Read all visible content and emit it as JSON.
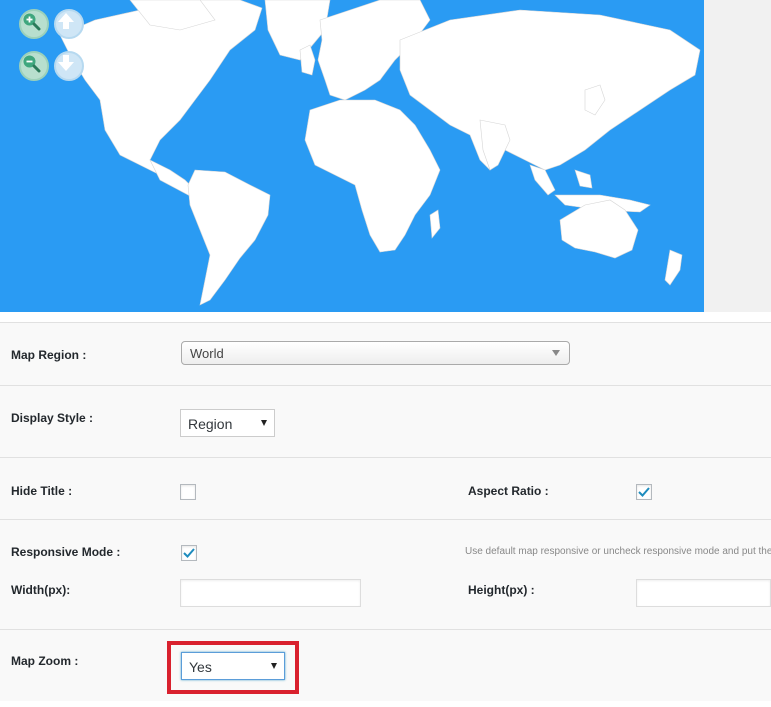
{
  "map": {
    "zoom_in_icon": "zoom-in-icon",
    "zoom_out_icon": "zoom-out-icon",
    "pan_up_icon": "arrow-up-icon",
    "pan_down_icon": "arrow-down-icon",
    "ocean_color": "#2a9bf3",
    "land_color": "#ffffff"
  },
  "form": {
    "map_region": {
      "label": "Map Region :",
      "value": "World"
    },
    "display_style": {
      "label": "Display Style :",
      "value": "Region"
    },
    "hide_title": {
      "label": "Hide Title :",
      "checked": false
    },
    "aspect_ratio": {
      "label": "Aspect Ratio :",
      "checked": true
    },
    "responsive_mode": {
      "label": "Responsive Mode :",
      "checked": true,
      "note": "Use default map responsive or uncheck responsive mode and put the"
    },
    "width": {
      "label": "Width(px):",
      "value": ""
    },
    "height": {
      "label": "Height(px) :",
      "value": ""
    },
    "map_zoom": {
      "label": "Map Zoom :",
      "value": "Yes"
    }
  },
  "colors": {
    "highlight": "#d9212e",
    "check": "#1e8cbe"
  }
}
